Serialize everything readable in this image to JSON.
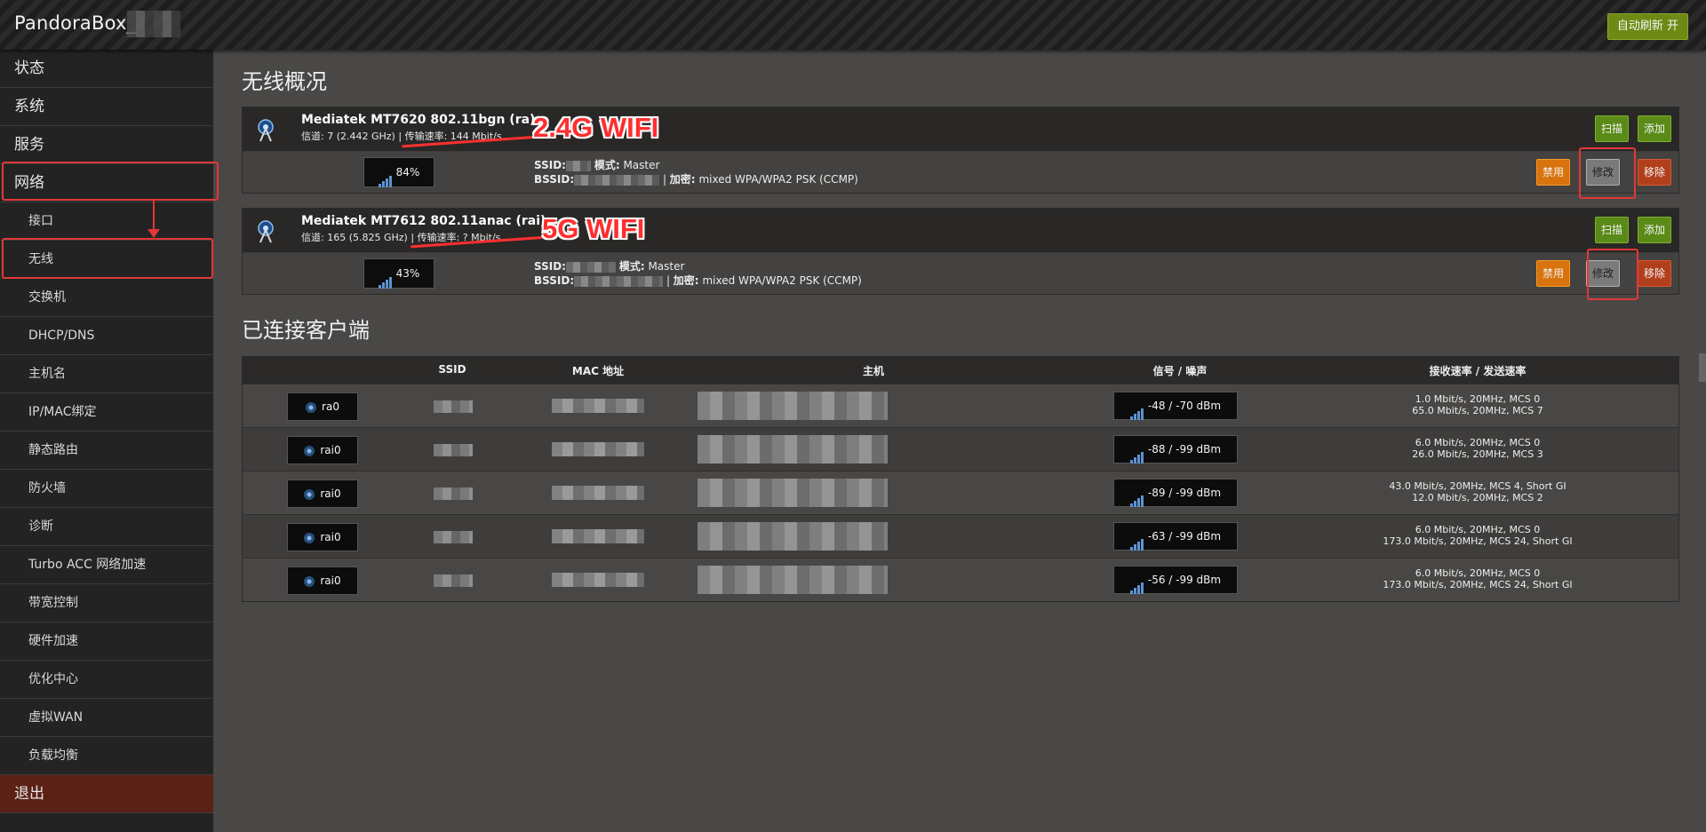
{
  "header": {
    "brand": "PandoraBox_",
    "auto_refresh": "自动刷新 开"
  },
  "sidebar": {
    "items": [
      {
        "label": "状态"
      },
      {
        "label": "系统"
      },
      {
        "label": "服务"
      },
      {
        "label": "网络"
      }
    ],
    "sub_items": [
      {
        "label": "接口"
      },
      {
        "label": "无线"
      },
      {
        "label": "交换机"
      },
      {
        "label": "DHCP/DNS"
      },
      {
        "label": "主机名"
      },
      {
        "label": "IP/MAC绑定"
      },
      {
        "label": "静态路由"
      },
      {
        "label": "防火墙"
      },
      {
        "label": "诊断"
      },
      {
        "label": "Turbo ACC 网络加速"
      },
      {
        "label": "带宽控制"
      },
      {
        "label": "硬件加速"
      },
      {
        "label": "优化中心"
      },
      {
        "label": "虚拟WAN"
      },
      {
        "label": "负载均衡"
      }
    ],
    "logout": "退出"
  },
  "overview": {
    "title": "无线概况",
    "devices": [
      {
        "name": "Mediatek MT7620 802.11bgn (ra)",
        "channel_label": "信道:",
        "channel_value": "7 (2.442 GHz)",
        "rate_label": "传输速率:",
        "rate_value": "144 Mbit/s",
        "signal": "84%",
        "ssid_label": "SSID:",
        "mode_label": "模式:",
        "mode_value": "Master",
        "bssid_label": "BSSID:",
        "enc_label": "加密:",
        "enc_value": "mixed WPA/WPA2 PSK (CCMP)",
        "annotation": "2.4G WIFI"
      },
      {
        "name": "Mediatek MT7612 802.11anac (rai)",
        "channel_label": "信道:",
        "channel_value": "165 (5.825 GHz)",
        "rate_label": "传输速率:",
        "rate_value": "? Mbit/s",
        "signal": "43%",
        "ssid_label": "SSID:",
        "mode_label": "模式:",
        "mode_value": "Master",
        "bssid_label": "BSSID:",
        "enc_label": "加密:",
        "enc_value": "mixed WPA/WPA2 PSK (CCMP)",
        "annotation": "5G WIFI"
      }
    ],
    "buttons": {
      "scan": "扫描",
      "add": "添加",
      "disable": "禁用",
      "edit": "修改",
      "remove": "移除"
    }
  },
  "clients": {
    "title": "已连接客户端",
    "headers": [
      "SSID",
      "MAC 地址",
      "主机",
      "信号 / 噪声",
      "接收速率 / 发送速率"
    ],
    "rows": [
      {
        "iface": "ra0",
        "signal": "-48 / -70 dBm",
        "rx": "1.0 Mbit/s, 20MHz, MCS 0",
        "tx": "65.0 Mbit/s, 20MHz, MCS 7"
      },
      {
        "iface": "rai0",
        "signal": "-88 / -99 dBm",
        "rx": "6.0 Mbit/s, 20MHz, MCS 0",
        "tx": "26.0 Mbit/s, 20MHz, MCS 3"
      },
      {
        "iface": "rai0",
        "signal": "-89 / -99 dBm",
        "rx": "43.0 Mbit/s, 20MHz, MCS 4, Short GI",
        "tx": "12.0 Mbit/s, 20MHz, MCS 2"
      },
      {
        "iface": "rai0",
        "signal": "-63 / -99 dBm",
        "rx": "6.0 Mbit/s, 20MHz, MCS 0",
        "tx": "173.0 Mbit/s, 20MHz, MCS 24, Short GI"
      },
      {
        "iface": "rai0",
        "signal": "-56 / -99 dBm",
        "rx": "6.0 Mbit/s, 20MHz, MCS 0",
        "tx": "173.0 Mbit/s, 20MHz, MCS 24, Short GI"
      }
    ]
  },
  "colors": {
    "highlight": "#e23838",
    "annotation": "#ff2f2f",
    "btn_green": "#5a8a17",
    "btn_orange": "#d9730d",
    "btn_red": "#b23f1c",
    "signal_blue": "#5d93d2"
  },
  "icons": {
    "device": "access-point-icon",
    "signal": "signal-bars-icon"
  }
}
